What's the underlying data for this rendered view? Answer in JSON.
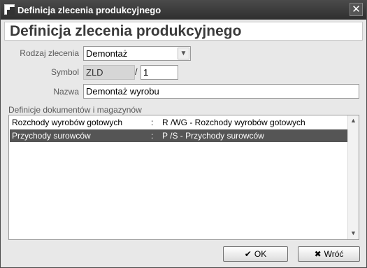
{
  "window": {
    "title": "Definicja zlecenia produkcyjnego",
    "close_symbol": "✕"
  },
  "header": {
    "heading": "Definicja zlecenia produkcyjnego"
  },
  "form": {
    "rodzaj_label": "Rodzaj zlecenia",
    "rodzaj_value": "Demontaż",
    "symbol_label": "Symbol",
    "symbol_value": "ZLD",
    "symbol_separator": "/",
    "symbol_number": "1",
    "nazwa_label": "Nazwa",
    "nazwa_value": "Demontaż wyrobu"
  },
  "list": {
    "section_label": "Definicje dokumentów i magazynów",
    "rows": [
      {
        "name": "Rozchody wyrobów gotowych",
        "separator": ":",
        "code": "R /WG  - Rozchody wyrobów gotowych"
      },
      {
        "name": "Przychody surowców",
        "separator": ":",
        "code": "P /S  - Przychody surowców"
      }
    ],
    "selected_index": 1
  },
  "buttons": {
    "ok_label": "OK",
    "back_label": "Wróć"
  },
  "icons": {
    "dropdown": "chevron-down-icon",
    "scroll_up": "arrow-up-icon",
    "scroll_down": "arrow-down-icon",
    "ok": "check-icon",
    "back": "x-icon"
  }
}
